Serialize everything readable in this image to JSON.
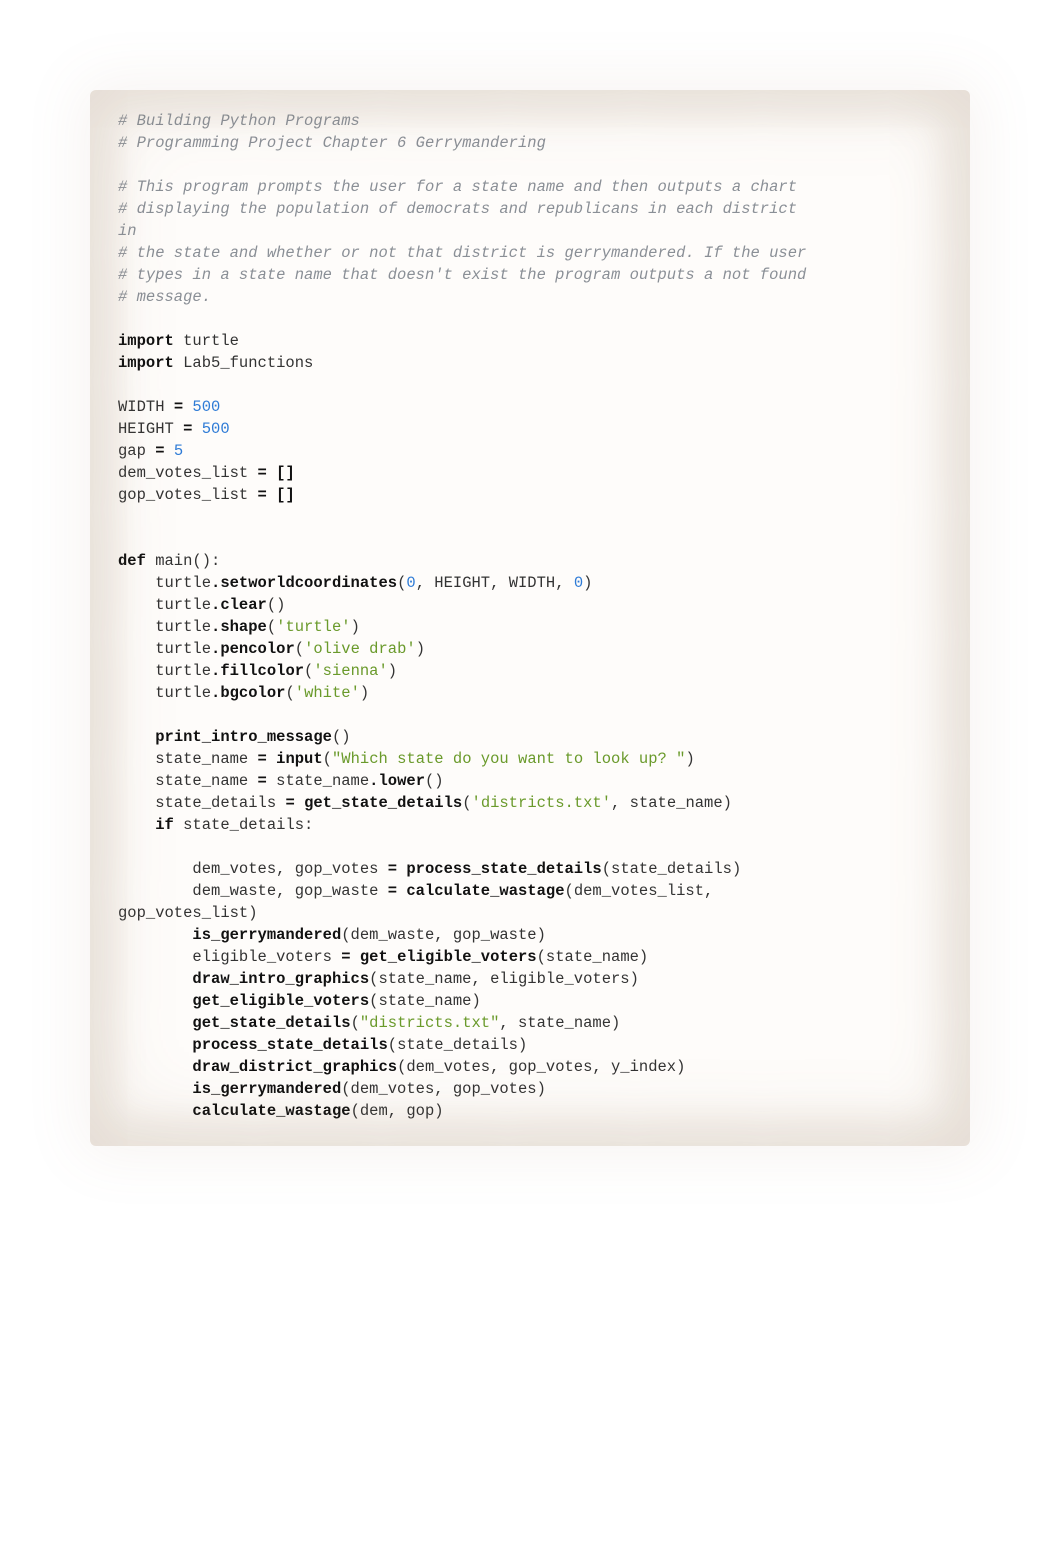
{
  "code": {
    "c1": "# Building Python Programs",
    "c2": "# Programming Project Chapter 6 Gerrymandering",
    "c3": "# This program prompts the user for a state name and then outputs a chart",
    "c4": "# displaying the population of democrats and republicans in each district",
    "c5a": "in",
    "c5": "# the state and whether or not that district is gerrymandered. If the user",
    "c6": "# types in a state name that doesn't exist the program outputs a not found",
    "c7": "# message.",
    "kw_import": "import",
    "mod_turtle": " turtle",
    "mod_lab5": " Lab5_functions",
    "w_width": "WIDTH ",
    "w_height": "HEIGHT ",
    "w_gap": "gap ",
    "w_dem_list": "dem_votes_list ",
    "w_gop_list": "gop_votes_list ",
    "eq": "=",
    "num_500a": " 500",
    "num_500b": " 500",
    "num_5": " 5",
    "brackets1": " []",
    "brackets2": " []",
    "kw_def": "def",
    "main_sig": " main():",
    "l_turtle": "    turtle",
    "dot": ".",
    "fn_setworld": "setworldcoordinates",
    "args_setworld_a": "(",
    "num_0a": "0",
    "args_setworld_b": ", HEIGHT, WIDTH, ",
    "num_0b": "0",
    "args_setworld_c": ")",
    "fn_clear": "clear",
    "paren_empty": "()",
    "fn_shape": "shape",
    "s_turtle": "'turtle'",
    "fn_pencolor": "pencolor",
    "s_olive": "'olive drab'",
    "fn_fillcolor": "fillcolor",
    "s_sienna": "'sienna'",
    "fn_bgcolor": "bgcolor",
    "s_white": "'white'",
    "open_p": "(",
    "close_p": ")",
    "ind4": "    ",
    "ind8": "        ",
    "b_print_intro": "print_intro_message",
    "l_state_name": "    state_name ",
    "b_input": "input",
    "s_prompt": "\"Which state do you want to look up? \"",
    "l_state_name2": "    state_name ",
    "tail_lower": " state_name",
    "fn_lower": "lower",
    "l_state_details": "    state_details ",
    "b_get_state": "get_state_details",
    "s_districts1": "'districts.txt'",
    "sep_state": ", state_name)",
    "kw_if": "if",
    "if_tail": " state_details:",
    "l_dv_gv": "        dem_votes, gop_votes ",
    "b_process": "process_state_details",
    "args_sd": "(state_details)",
    "l_dw_gw": "        dem_waste, gop_waste ",
    "b_calcwaste": "calculate_wastage",
    "args_lists_a": "(dem_votes_list,",
    "wrap_gop": "gop_votes_list)",
    "b_isgerry": "is_gerrymandered",
    "args_waste": "(dem_waste, gop_waste)",
    "l_elig": "        eligible_voters ",
    "b_getelig": "get_eligible_voters",
    "args_state": "(state_name)",
    "b_drawintro": "draw_intro_graphics",
    "args_intro": "(state_name, eligible_voters)",
    "s_districts2": "\"districts.txt\"",
    "b_drawdist": "draw_district_graphics",
    "args_dist": "(dem_votes, gop_votes, y_index)",
    "args_votes": "(dem_votes, gop_votes)",
    "args_demgop": "(dem, gop)"
  }
}
